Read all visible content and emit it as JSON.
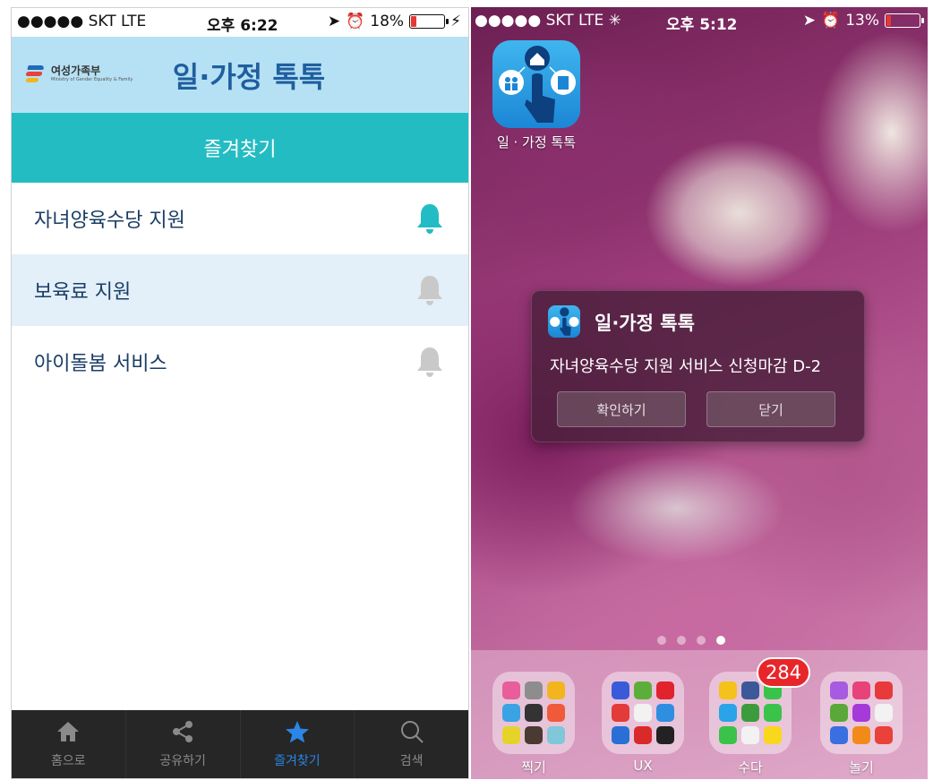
{
  "left_phone": {
    "status": {
      "carrier": "●●●●● SKT  LTE",
      "time": "오후 6:22",
      "battery": "18%",
      "battery_level": 0.18
    },
    "header": {
      "logo_text": "여성가족부",
      "logo_subtext": "Ministry of Gender Equality & Family",
      "title": "일·가정 톡톡"
    },
    "section_title": "즐겨찾기",
    "favorites": [
      {
        "label": "자녀양육수당 지원",
        "bell_color": "#22bcc5"
      },
      {
        "label": "보육료 지원",
        "bell_color": "#c9c9c9"
      },
      {
        "label": "아이돌봄 서비스",
        "bell_color": "#c9c9c9"
      }
    ],
    "tabs": [
      {
        "label": "홈으로",
        "icon": "home-icon"
      },
      {
        "label": "공유하기",
        "icon": "share-icon"
      },
      {
        "label": "즐겨찾기",
        "icon": "star-icon",
        "active": true
      },
      {
        "label": "검색",
        "icon": "search-icon"
      }
    ]
  },
  "right_phone": {
    "status": {
      "carrier": "●●●●● SKT  LTE ✳",
      "time": "오후 5:12",
      "battery": "13%",
      "battery_level": 0.13
    },
    "app_icon_label": "일 · 가정 톡톡",
    "notification": {
      "title": "일·가정 톡톡",
      "message": "자녀양육수당 지원 서비스 신청마감 D-2",
      "confirm_label": "확인하기",
      "close_label": "닫기"
    },
    "page_dots": {
      "count": 4,
      "active_index": 3
    },
    "dock": {
      "badge": "284",
      "folders": [
        {
          "label": "찍기"
        },
        {
          "label": "UX"
        },
        {
          "label": "수다"
        },
        {
          "label": "놀기"
        }
      ]
    }
  },
  "colors": {
    "header_bg": "#b6e1f4",
    "section_bg": "#24bcc3",
    "alt_row_bg": "#e3eff9",
    "tabbar_bg": "#262626",
    "active_tab": "#2a86e8",
    "badge": "#e8262a"
  }
}
